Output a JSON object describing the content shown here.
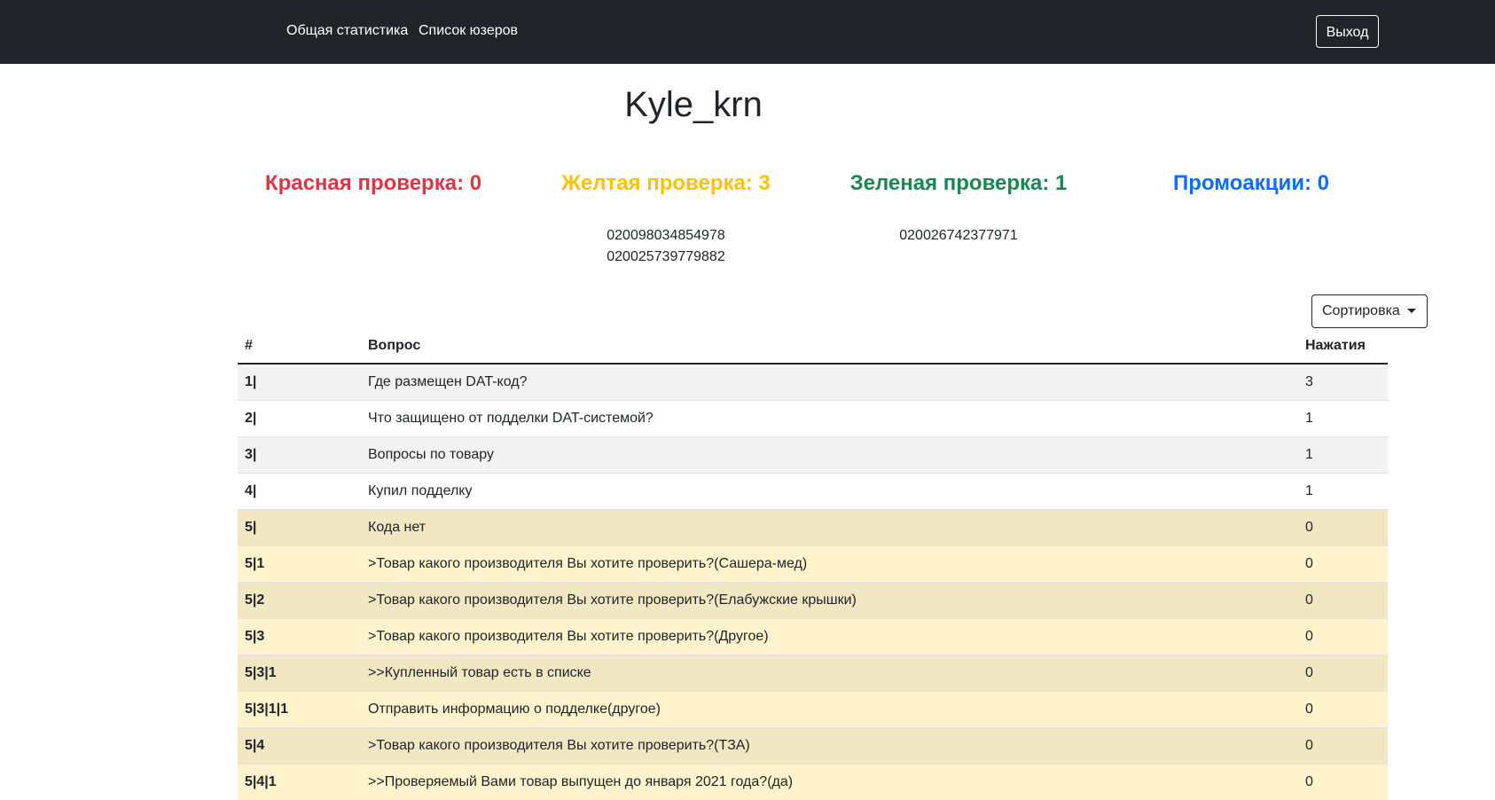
{
  "nav": {
    "links": [
      "Общая статистика",
      "Список юзеров"
    ],
    "logout_label": "Выход"
  },
  "user": {
    "name": "Kyle_krn"
  },
  "stats": {
    "red": "Красная проверка: 0",
    "yellow": "Желтая проверка: 3",
    "green": "Зеленая проверка: 1",
    "promo": "Промоакции: 0",
    "yellow_codes": [
      "020098034854978",
      "020025739779882"
    ],
    "green_codes": [
      "020026742377971"
    ]
  },
  "colors": {
    "navbar": "#212529",
    "red": "#dc3545",
    "yellow": "#ffc107",
    "green": "#198754",
    "blue": "#0d6efd",
    "warning_row": "#fff3cd"
  },
  "sort": {
    "label": "Сортировка"
  },
  "table": {
    "headers": [
      "#",
      "Вопрос",
      "Нажатия"
    ],
    "rows": [
      {
        "num": "1|",
        "question": "Где размещен DAT-код?",
        "clicks": "3",
        "style": "plain"
      },
      {
        "num": "2|",
        "question": "Что защищено от подделки DAT-системой?",
        "clicks": "1",
        "style": "plain"
      },
      {
        "num": "3|",
        "question": "Вопросы по товару",
        "clicks": "1",
        "style": "plain"
      },
      {
        "num": "4|",
        "question": "Купил подделку",
        "clicks": "1",
        "style": "plain"
      },
      {
        "num": "5|",
        "question": "Кода нет",
        "clicks": "0",
        "style": "warn"
      },
      {
        "num": "5|1",
        "question": ">Товар какого производителя Вы хотите проверить?(Сашера-мед)",
        "clicks": "0",
        "style": "warn"
      },
      {
        "num": "5|2",
        "question": ">Товар какого производителя Вы хотите проверить?(Елабужские крышки)",
        "clicks": "0",
        "style": "warn"
      },
      {
        "num": "5|3",
        "question": ">Товар какого производителя Вы хотите проверить?(Другое)",
        "clicks": "0",
        "style": "warn"
      },
      {
        "num": "5|3|1",
        "question": ">>Купленный товар есть в списке",
        "clicks": "0",
        "style": "warn"
      },
      {
        "num": "5|3|1|1",
        "question": "Отправить информацию о подделке(другое)",
        "clicks": "0",
        "style": "warn"
      },
      {
        "num": "5|4",
        "question": ">Товар какого производителя Вы хотите проверить?(ТЗА)",
        "clicks": "0",
        "style": "warn"
      },
      {
        "num": "5|4|1",
        "question": ">>Проверяемый Вами товар выпущен до января 2021 года?(да)",
        "clicks": "0",
        "style": "warn"
      }
    ]
  }
}
